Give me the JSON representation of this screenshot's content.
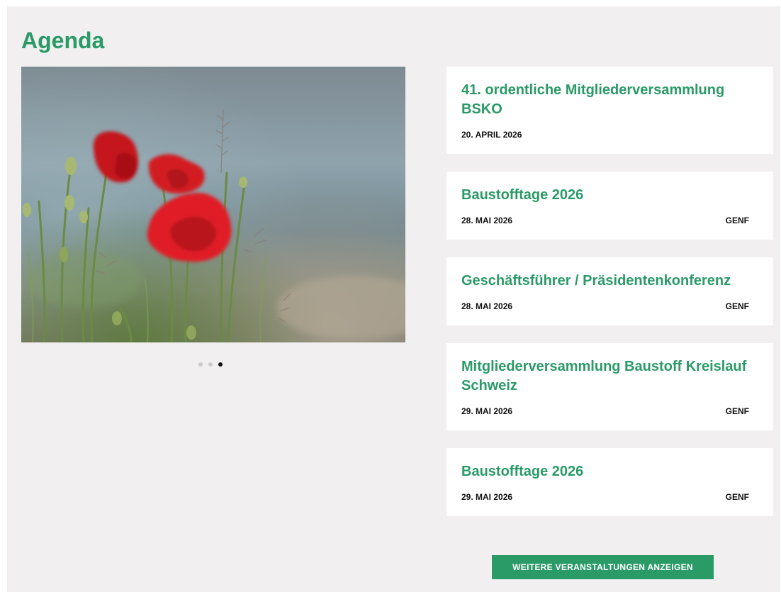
{
  "header": {
    "title": "Agenda"
  },
  "carousel": {
    "slide_count": 3,
    "active_index": 2,
    "image_subject": "red-poppies-photo"
  },
  "events": [
    {
      "title": "41. ordentliche Mitgliederversammlung BSKO",
      "date": "20. APRIL 2026",
      "location": ""
    },
    {
      "title": "Baustofftage 2026",
      "date": "28. MAI 2026",
      "location": "GENF"
    },
    {
      "title": "Geschäftsführer / Präsidentenkonferenz",
      "date": "28. MAI 2026",
      "location": "GENF"
    },
    {
      "title": "Mitgliederversammlung Baustoff Kreislauf Schweiz",
      "date": "29. MAI 2026",
      "location": "GENF"
    },
    {
      "title": "Baustofftage 2026",
      "date": "29. MAI 2026",
      "location": "GENF"
    }
  ],
  "footer": {
    "more_label": "WEITERE VERANSTALTUNGEN ANZEIGEN"
  },
  "colors": {
    "accent": "#2a9a67",
    "panel_background": "#f1eff0",
    "card_background": "#ffffff",
    "meta_text": "#111111"
  }
}
